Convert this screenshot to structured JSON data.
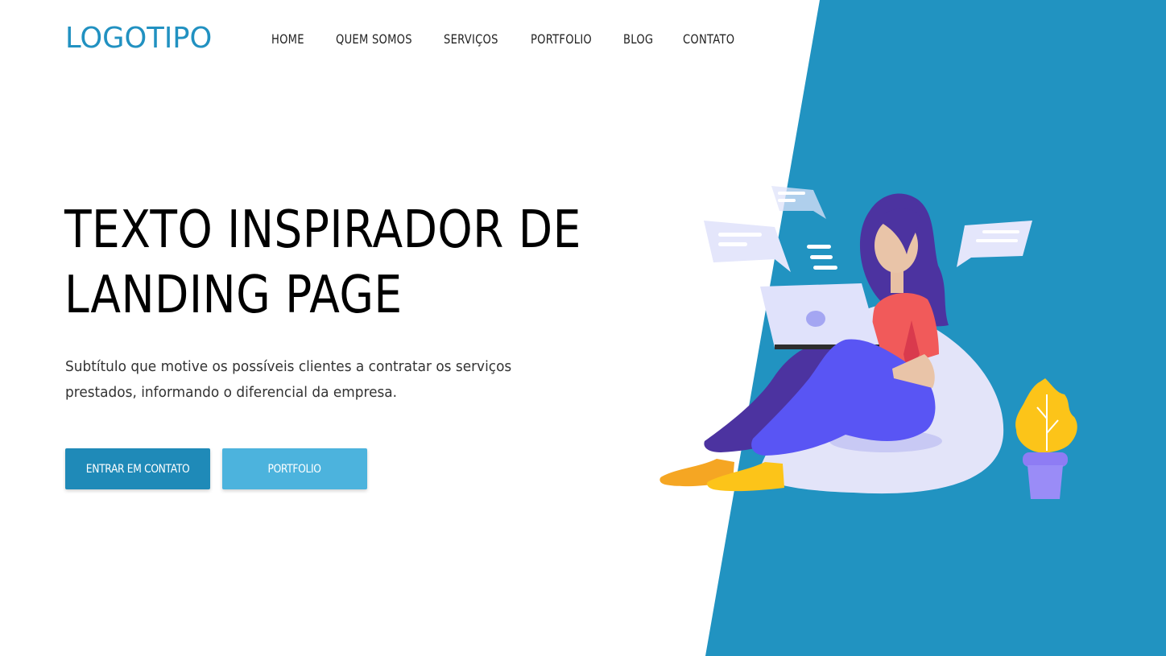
{
  "colors": {
    "brand": "#2191c1",
    "panel": "#2193c1",
    "button_primary": "#1f8ab8",
    "button_secondary": "#4cb3dd",
    "text_dark": "#000000"
  },
  "header": {
    "logo": "LOGOTIPO",
    "nav": [
      "HOME",
      "QUEM SOMOS",
      "SERVIÇOS",
      "PORTFOLIO",
      "BLOG",
      "CONTATO"
    ]
  },
  "hero": {
    "title_lines": [
      "TEXTO INSPIRADOR DE",
      "LANDING PAGE"
    ],
    "subtitle_lines": [
      "Subtítulo que motive os possíveis clientes a contratar os serviços",
      "prestados, informando o diferencial da empresa."
    ],
    "primary_button": "ENTRAR EM CONTATO",
    "secondary_button": "PORTFOLIO"
  },
  "illustration": {
    "icon": "woman-with-laptop-illustration"
  }
}
